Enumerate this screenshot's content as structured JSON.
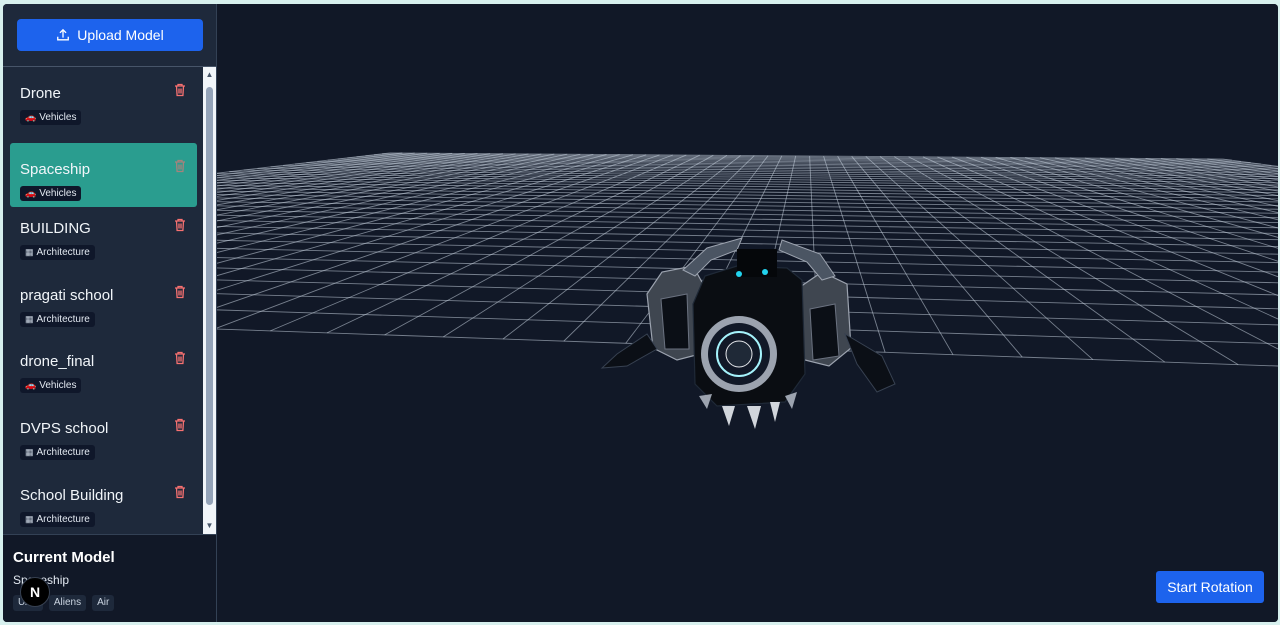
{
  "toolbar": {
    "upload_label": "Upload Model"
  },
  "models": [
    {
      "name": "Drone",
      "category": "Vehicles",
      "icon": "car-icon",
      "active": false
    },
    {
      "name": "Spaceship",
      "category": "Vehicles",
      "icon": "car-icon",
      "active": true
    },
    {
      "name": "BUILDING",
      "category": "Architecture",
      "icon": "building-icon",
      "active": false
    },
    {
      "name": "pragati school",
      "category": "Architecture",
      "icon": "building-icon",
      "active": false
    },
    {
      "name": "drone_final",
      "category": "Vehicles",
      "icon": "car-icon",
      "active": false
    },
    {
      "name": "DVPS school",
      "category": "Architecture",
      "icon": "building-icon",
      "active": false
    },
    {
      "name": "School Building",
      "category": "Architecture",
      "icon": "building-icon",
      "active": false
    }
  ],
  "current": {
    "title": "Current Model",
    "name": "Spaceship",
    "tags": [
      "UAV",
      "Aliens",
      "Air"
    ]
  },
  "avatar": {
    "letter": "N"
  },
  "viewport": {
    "rotate_label": "Start Rotation"
  },
  "colors": {
    "accent": "#1d63ed",
    "active_item": "#2a9d8f",
    "danger": "#f87171",
    "bg": "#111827",
    "sidebar": "#1e293b"
  }
}
